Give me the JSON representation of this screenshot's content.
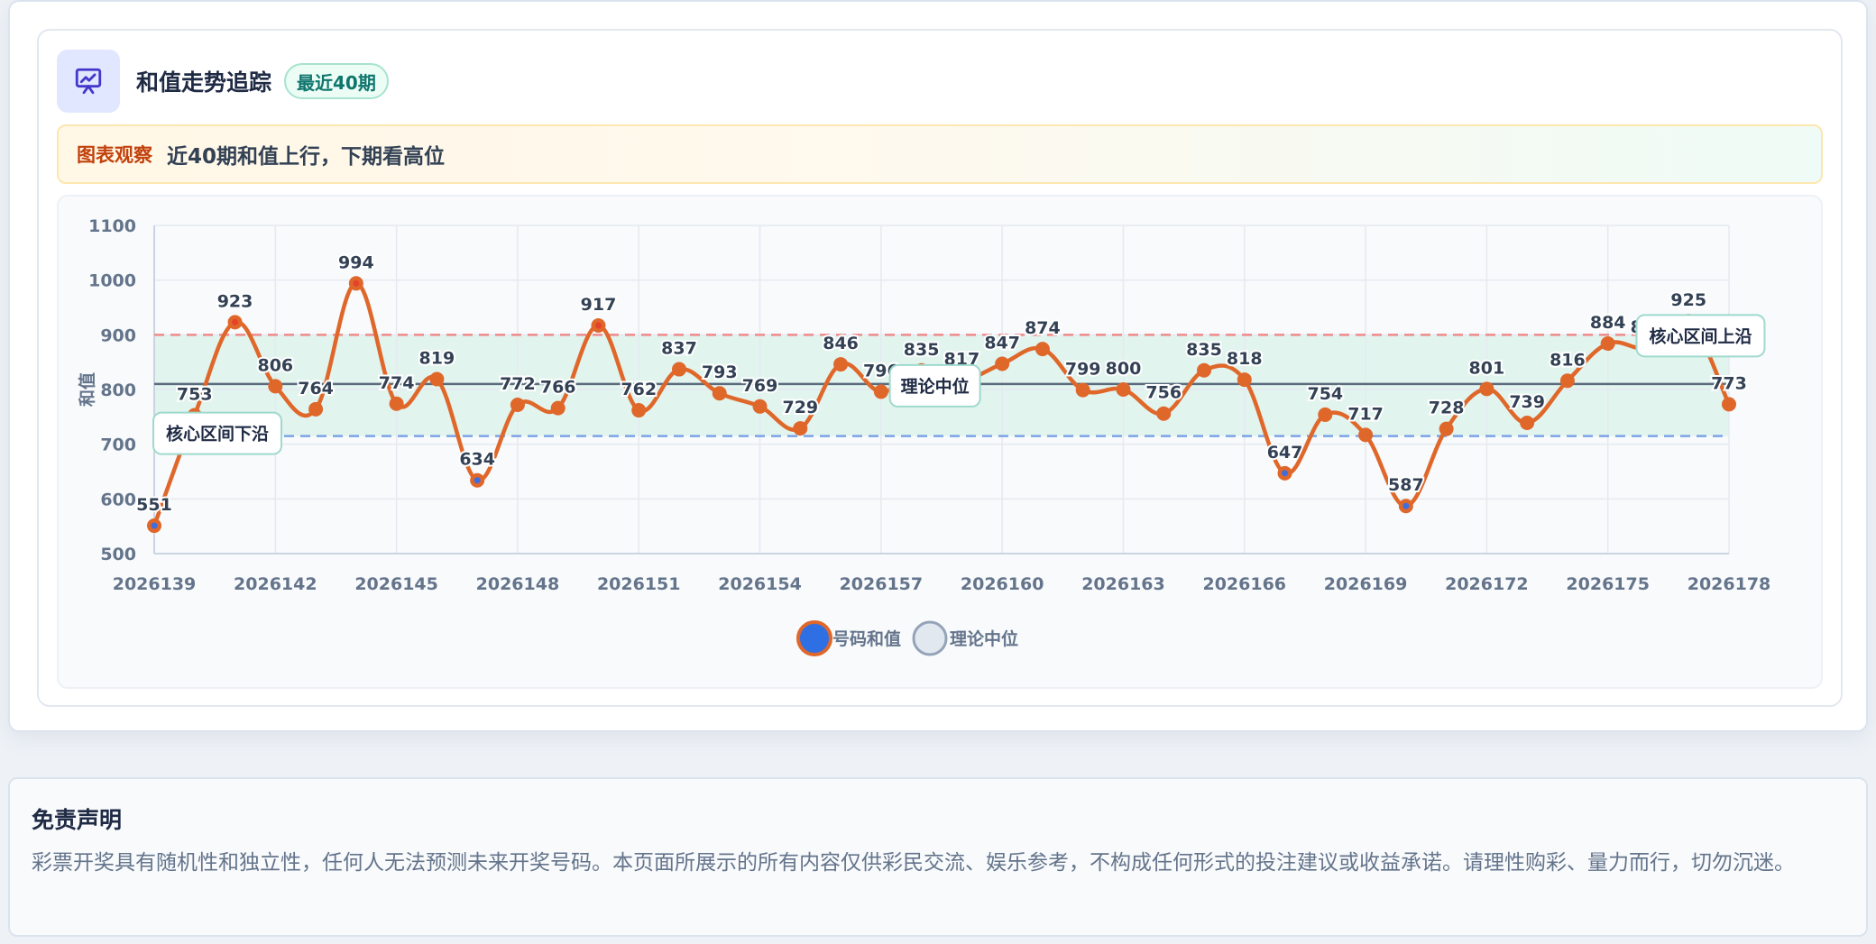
{
  "header": {
    "title": "和值走势追踪",
    "badge": "最近40期",
    "icon": "presentation-chart-icon"
  },
  "insight": {
    "label": "图表观察",
    "text": "近40期和值上行，下期看高位"
  },
  "disclaimer": {
    "title": "免责声明",
    "text": "彩票开奖具有随机性和独立性，任何人无法预测未来开奖号码。本页面所展示的所有内容仅供彩民交流、娱乐参考，不构成任何形式的投注建议或收益承诺。请理性购彩、量力而行，切勿沉迷。"
  },
  "colors": {
    "series": "#e0672a",
    "point_high": "#e5412b",
    "point_low": "#3b6fe0",
    "median": "#5b6a7d",
    "upper_line": "#ef8a8a",
    "lower_line": "#7ba3e6",
    "band": "#d9f2ea"
  },
  "chart_data": {
    "type": "line",
    "title": "",
    "xlabel": "",
    "ylabel": "和值",
    "ylim": [
      500,
      1100
    ],
    "yticks": [
      "500",
      "600",
      "700",
      "800",
      "900",
      "1000",
      "1100"
    ],
    "x": [
      "2026139",
      "2026140",
      "2026141",
      "2026142",
      "2026143",
      "2026144",
      "2026145",
      "2026146",
      "2026147",
      "2026148",
      "2026149",
      "2026150",
      "2026151",
      "2026152",
      "2026153",
      "2026154",
      "2026155",
      "2026156",
      "2026157",
      "2026158",
      "2026159",
      "2026160",
      "2026161",
      "2026162",
      "2026163",
      "2026164",
      "2026165",
      "2026166",
      "2026167",
      "2026168",
      "2026169",
      "2026170",
      "2026171",
      "2026172",
      "2026173",
      "2026174",
      "2026175",
      "2026176",
      "2026177",
      "2026178"
    ],
    "xticks": [
      "2026139",
      "2026142",
      "2026145",
      "2026148",
      "2026151",
      "2026154",
      "2026157",
      "2026160",
      "2026163",
      "2026166",
      "2026169",
      "2026172",
      "2026175",
      "2026178"
    ],
    "series": [
      {
        "name": "号码和值",
        "values": [
          551,
          753,
          923,
          806,
          764,
          994,
          774,
          819,
          634,
          772,
          766,
          917,
          762,
          837,
          793,
          769,
          729,
          846,
          796,
          835,
          817,
          847,
          874,
          799,
          800,
          756,
          835,
          818,
          647,
          754,
          717,
          587,
          728,
          801,
          739,
          816,
          884,
          876,
          925,
          773
        ]
      }
    ],
    "median_name": "理论中位",
    "median_value": 810,
    "band": {
      "lower": 715,
      "upper": 900
    },
    "annotations": {
      "lower": "核心区间下沿",
      "median": "理论中位",
      "upper": "核心区间上沿"
    },
    "grid": true,
    "legend_position": "bottom-center"
  }
}
